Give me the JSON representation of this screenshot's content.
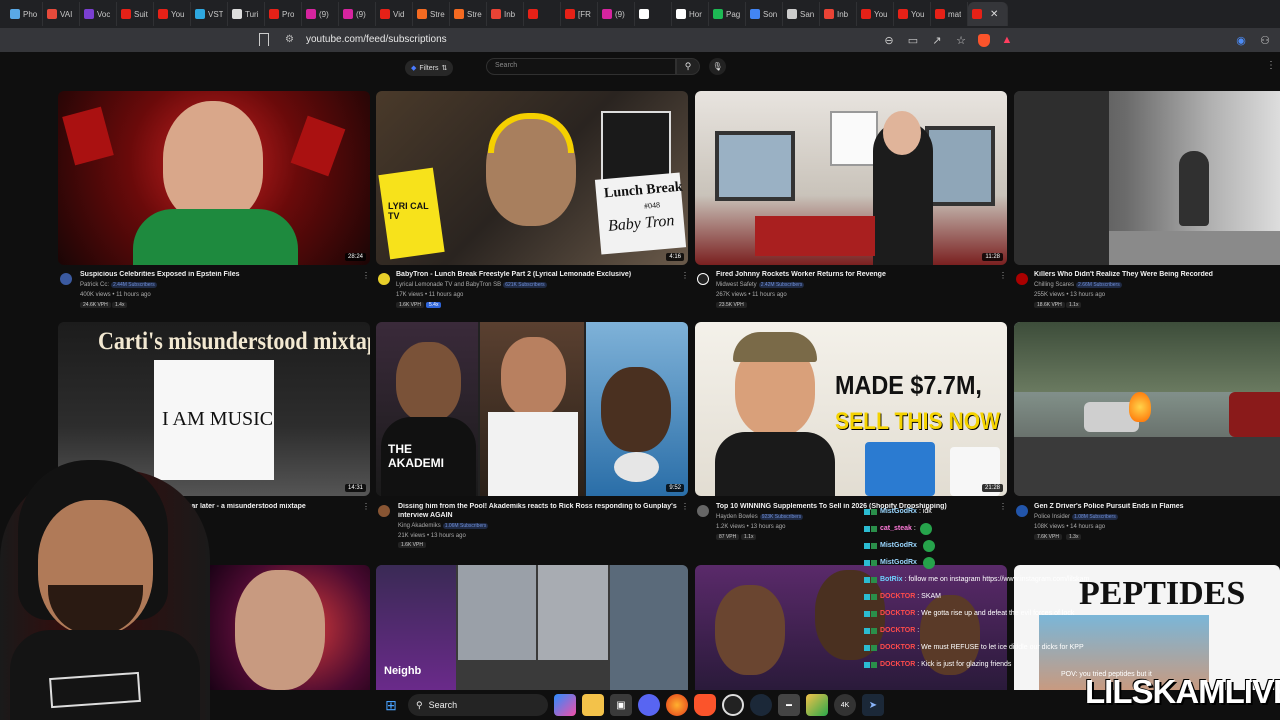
{
  "browser": {
    "tabs": [
      {
        "label": "Pho",
        "color": "#5aa9e6"
      },
      {
        "label": "VAI",
        "color": "#e64a3b"
      },
      {
        "label": "Voc",
        "color": "#7a3fd1"
      },
      {
        "label": "Suit",
        "color": "#e62117"
      },
      {
        "label": "You",
        "color": "#e62117"
      },
      {
        "label": "VST",
        "color": "#2ea8e0"
      },
      {
        "label": "Turi",
        "color": "#dddddd"
      },
      {
        "label": "Pro",
        "color": "#e62117"
      },
      {
        "label": "(9)",
        "color": "#d6249f"
      },
      {
        "label": "(9)",
        "color": "#d6249f"
      },
      {
        "label": "Vid",
        "color": "#e62117"
      },
      {
        "label": "Stre",
        "color": "#f46a21"
      },
      {
        "label": "Stre",
        "color": "#f46a21"
      },
      {
        "label": "Inb",
        "color": "#ea4335"
      },
      {
        "label": "",
        "color": "#e62117"
      },
      {
        "label": "[FR",
        "color": "#e62117"
      },
      {
        "label": "(9)",
        "color": "#d6249f"
      },
      {
        "label": "",
        "color": "#ffffff"
      },
      {
        "label": "Hor",
        "color": "#ffffff"
      },
      {
        "label": "Pag",
        "color": "#1db954"
      },
      {
        "label": "Son",
        "color": "#4285f4"
      },
      {
        "label": "San",
        "color": "#cccccc"
      },
      {
        "label": "Inb",
        "color": "#ea4335"
      },
      {
        "label": "You",
        "color": "#e62117"
      },
      {
        "label": "You",
        "color": "#e62117"
      },
      {
        "label": "mat",
        "color": "#e62117"
      },
      {
        "label": "",
        "color": "#e62117",
        "active": true
      }
    ],
    "url": "youtube.com/feed/subscriptions",
    "tab_close": "✕"
  },
  "youtube": {
    "filters_label": "Filters",
    "search_placeholder": "Search"
  },
  "videos": [
    {
      "title": "Suspicious Celebrities Exposed in Epstein Files",
      "channel": "Patrick Cc:",
      "subs": "2.44M Subscribers",
      "meta": "400K views • 11 hours ago",
      "vph": "24.6K VPH",
      "vph2": "1.4x",
      "duration": "28:24"
    },
    {
      "title": "BabyTron - Lunch Break Freestyle Part 2 (Lyrical Lemonade Exclusive)",
      "channel": "Lyrical Lemonade TV",
      "channel2": "and BabyTron SB",
      "subs": "621K Subscribers",
      "meta": "17K views • 11 hours ago",
      "vph": "1.6K VPH",
      "vph2": "5.4x",
      "duration": "4:16"
    },
    {
      "title": "Fired Johnny Rockets Worker Returns for Revenge",
      "channel": "Midwest Safety",
      "subs": "2.42M Subscribers",
      "meta": "267K views • 11 hours ago",
      "vph": "23.5K VPH",
      "duration": "11:28"
    },
    {
      "title": "Killers Who Didn't Realize They Were Being Recorded",
      "channel": "Chilling Scares",
      "subs": "2.66M Subscribers",
      "meta": "255K views • 13 hours ago",
      "vph": "18.6K VPH",
      "vph2": "1.1x",
      "duration": ""
    },
    {
      "title": "I Am Music by Playboi Carti 1 year later - a misunderstood mixtape?",
      "channel": "",
      "meta": "",
      "duration": "14:31"
    },
    {
      "title": "Dissing him from the Pool! Akademiks reacts to Rick Ross responding to Gunplay's",
      "title2": "interview AGAIN",
      "channel": "King Akademiks",
      "subs": "1.06M Subscribers",
      "meta": "21K views • 13 hours ago",
      "vph": "1.6K VPH",
      "duration": "9:52"
    },
    {
      "title": "Top 10 WINNING Supplements To Sell in 2026 (Shopify Dropshipping)",
      "channel": "Hayden Bowles",
      "subs": "923K Subscribers",
      "meta": "1.2K views • 13 hours ago",
      "vph": "87 VPH",
      "vph2": "1.1x",
      "duration": "21:28"
    },
    {
      "title": "Gen Z Driver's Police Pursuit Ends in Flames",
      "channel": "Police Insider",
      "subs": "1.08M Subscribers",
      "meta": "108K views • 14 hours ago",
      "vph": "7.6K VPH",
      "vph2": "1.3x",
      "duration": ""
    }
  ],
  "thumb_text": {
    "lunch_break": "Lunch Break",
    "lunch_num": "#048",
    "baby_tron": "Baby Tron",
    "lyrical": "LYRI CAL TV",
    "carti_title": "Carti's misunderstood mixtape?",
    "i_am_music": "I AM MUSIC",
    "made": "MADE $7.7M,",
    "sell": "SELL THIS NOW",
    "akademiks": "THE AKADEMI",
    "peptides": "PEPTIDES",
    "neighbor": "Neighb",
    "pov": "POV: you tried peptides but it"
  },
  "chat": [
    {
      "name": "MistGodRx",
      "msg": ": idk",
      "color": "#9ad7ff"
    },
    {
      "name": "cat_steak",
      "msg": ":",
      "color": "#ff7ad9",
      "emote": true
    },
    {
      "name": "MistGodRx",
      "msg": "",
      "color": "#9ad7ff",
      "emote": true
    },
    {
      "name": "MistGodRx",
      "msg": "",
      "color": "#9ad7ff",
      "emote": true
    },
    {
      "name": "BotRix",
      "msg": ": follow me on instagram https://www.instagram.com/lilskam",
      "color": "#6fd3ff"
    },
    {
      "name": "DOCKTOR",
      "msg": ": SKAM",
      "color": "#ff4b4b"
    },
    {
      "name": "DOCKTOR",
      "msg": ": We gotta rise up and defeat the evil forces of lock",
      "color": "#ff4b4b"
    },
    {
      "name": "DOCKTOR",
      "msg": ":",
      "color": "#ff4b4b"
    },
    {
      "name": "DOCKTOR",
      "msg": ": We must REFUSE to let ice diddle our dicks for KPP",
      "color": "#ff4b4b"
    },
    {
      "name": "DOCKTOR",
      "msg": ": Kick is just for glazing friends",
      "color": "#ff4b4b"
    }
  ],
  "taskbar": {
    "search_label": "Search",
    "icons": [
      "windows-icon",
      "widgets-icon",
      "copilot-icon",
      "file-explorer-icon",
      "store-icon",
      "discord-icon",
      "firefox-icon",
      "brave-icon",
      "obs-icon",
      "steam-icon",
      "app-icon",
      "app2-icon",
      "4k-icon",
      "steam2-icon"
    ]
  },
  "watermark": "LILSKAMLIVE",
  "colors": {
    "accent": "#3ea6ff",
    "youtube_red": "#ff0000",
    "bg": "#0f0f0f"
  }
}
